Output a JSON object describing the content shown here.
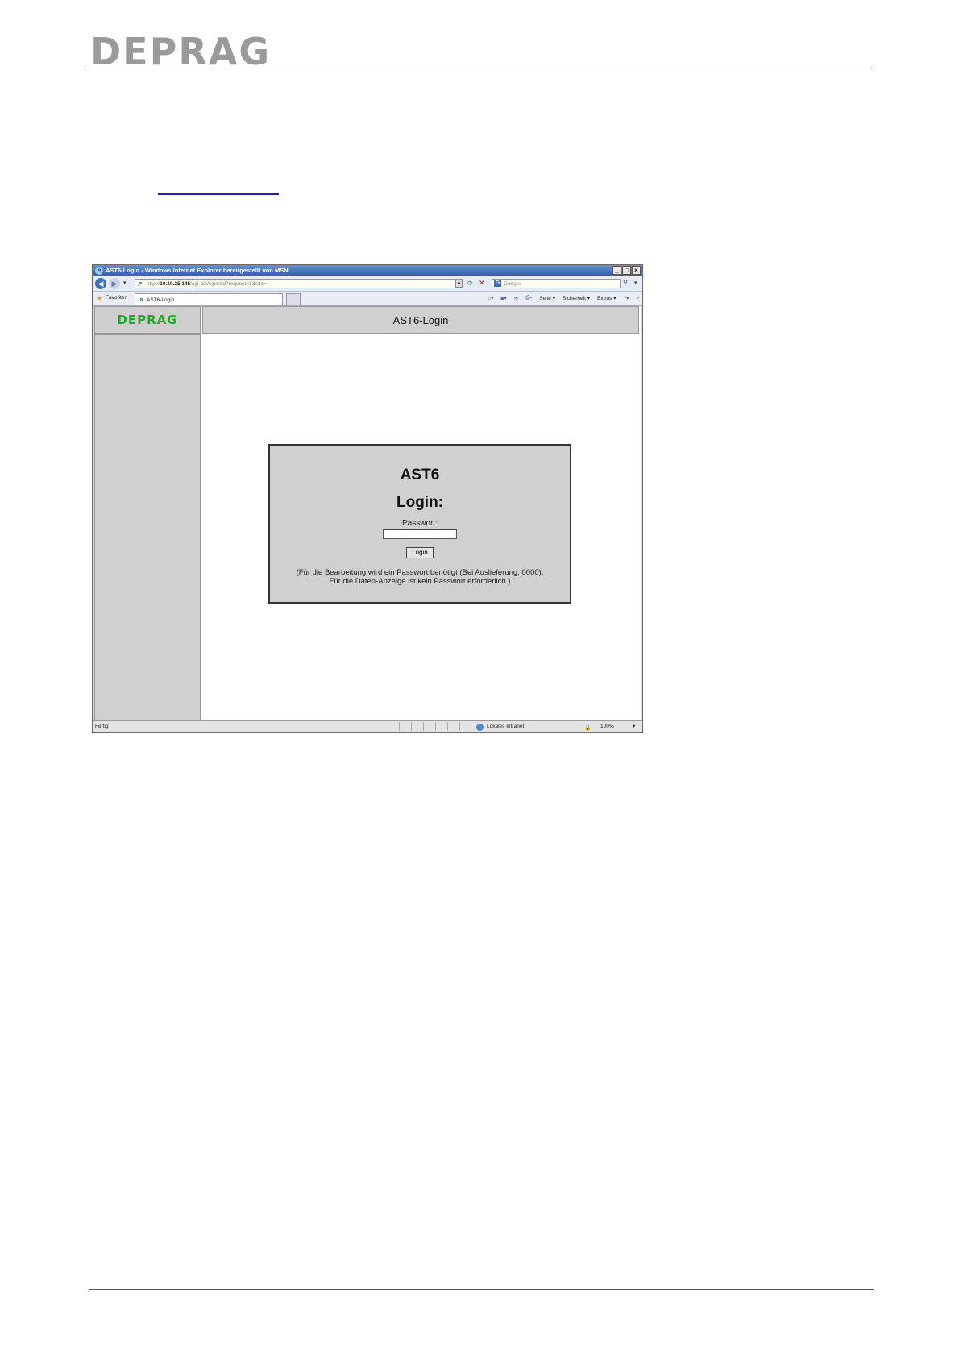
{
  "document": {
    "logo": "DEPRAG"
  },
  "browser": {
    "title": "AST6-Login - Windows Internet Explorer bereitgestellt von MSN",
    "url_prefix": "http://",
    "url_host": "10.10.25.145",
    "url_path": "/cgi-bin/cgimod?request=1&site=",
    "search_placeholder": "Google",
    "favorites_label": "Favoriten",
    "tab_label": "AST6-Login",
    "toolbar": {
      "page": "Seite ▾",
      "safety": "Sicherheit ▾",
      "extras": "Extras ▾"
    },
    "status": {
      "text": "Fertig",
      "zone": "Lokales Intranet",
      "zoom": "100%"
    }
  },
  "app": {
    "logo": "DEPRAG",
    "header_title": "AST6-Login",
    "login": {
      "title": "AST6",
      "subtitle": "Login:",
      "password_label": "Passwort:",
      "password_value": "",
      "button_label": "Login",
      "note_line1": "(Für die Bearbeitung wird ein Passwort benötigt (Bei Auslieferung: 0000).",
      "note_line2": "Für die Daten-Anzeige ist kein Passwort erforderlich.)"
    }
  },
  "colors": {
    "logo_green": "#22a52a",
    "doc_logo_gray": "#9a9a9a",
    "panel_gray": "#d0d0d0",
    "titlebar_blue": "#2e5cb0"
  }
}
